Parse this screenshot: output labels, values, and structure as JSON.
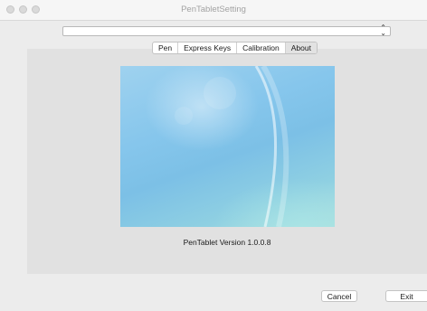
{
  "window": {
    "title": "PenTabletSetting"
  },
  "device_select": {
    "value": ""
  },
  "tabs": [
    {
      "label": "Pen",
      "active": false
    },
    {
      "label": "Express Keys",
      "active": false
    },
    {
      "label": "Calibration",
      "active": false
    },
    {
      "label": "About",
      "active": true
    }
  ],
  "about": {
    "version_text": "PenTablet Version  1.0.0.8"
  },
  "footer": {
    "cancel_label": "Cancel",
    "exit_label": "Exit"
  }
}
